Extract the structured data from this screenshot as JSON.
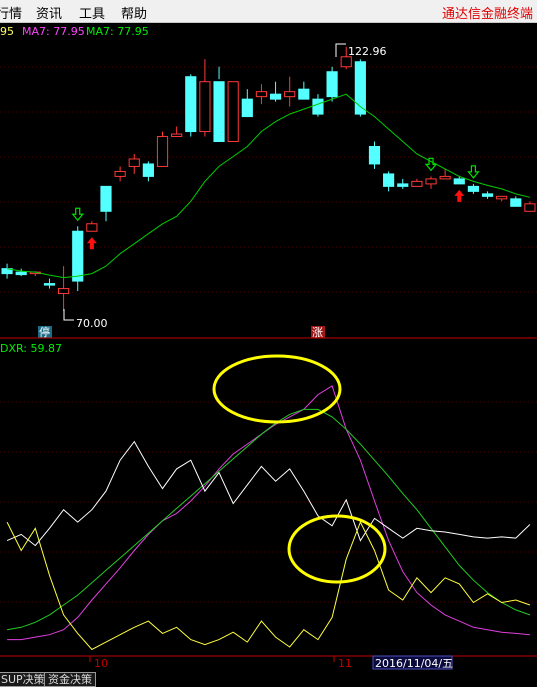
{
  "app": {
    "brand": "通达信金融终端"
  },
  "menu": [
    {
      "label": "行情"
    },
    {
      "label": "资讯"
    },
    {
      "label": "工具"
    },
    {
      "label": "帮助"
    }
  ],
  "colors": {
    "up": "#ff3838",
    "down": "#54ffff",
    "ma": "#00cc00",
    "ma_label_pink": "#ff44ff",
    "axis": "#c00000",
    "signal_buy": "#ff1010",
    "signal_sell": "#00dd00",
    "highlight": "#ffff00"
  },
  "main_chart": {
    "ma_labels": [
      "95",
      "MA7: 77.95",
      "MA7: 77.95"
    ],
    "high_label": "122.96",
    "low_label": "70.00",
    "badges": [
      "停",
      "涨"
    ]
  },
  "indicator": {
    "label": "DXR: 59.87"
  },
  "axis": {
    "labels": [
      "10",
      "11"
    ],
    "cursor_date": "2016/11/04/五"
  },
  "tabs": [
    {
      "label": "SUP决策"
    },
    {
      "label": "资金决策"
    }
  ],
  "chart_data": {
    "type": "candlestick",
    "candles": [
      {
        "o": 78.5,
        "h": 79.5,
        "l": 76.5,
        "c": 77.5
      },
      {
        "o": 77.8,
        "h": 78.5,
        "l": 77,
        "c": 77.3
      },
      {
        "o": 77.5,
        "h": 78,
        "l": 77,
        "c": 77.8
      },
      {
        "o": 75.5,
        "h": 76.5,
        "l": 74.5,
        "c": 75.2
      },
      {
        "o": 73.5,
        "h": 79,
        "l": 70,
        "c": 74.5
      },
      {
        "o": 86,
        "h": 87,
        "l": 74,
        "c": 76
      },
      {
        "o": 86,
        "h": 88,
        "l": 86,
        "c": 87.5
      },
      {
        "o": 95,
        "h": 95,
        "l": 88,
        "c": 90
      },
      {
        "o": 97,
        "h": 99,
        "l": 96,
        "c": 98
      },
      {
        "o": 99,
        "h": 101.5,
        "l": 97.5,
        "c": 100.5
      },
      {
        "o": 99.5,
        "h": 100,
        "l": 96,
        "c": 97
      },
      {
        "o": 99,
        "h": 106,
        "l": 99,
        "c": 105
      },
      {
        "o": 105,
        "h": 107,
        "l": 105,
        "c": 105.5
      },
      {
        "o": 117,
        "h": 117.5,
        "l": 105,
        "c": 106
      },
      {
        "o": 106,
        "h": 120.5,
        "l": 105,
        "c": 116
      },
      {
        "o": 116,
        "h": 119,
        "l": 116.5,
        "c": 104
      },
      {
        "o": 104,
        "h": 110,
        "l": 104,
        "c": 116
      },
      {
        "o": 112.5,
        "h": 114.5,
        "l": 111,
        "c": 109
      },
      {
        "o": 113,
        "h": 115.5,
        "l": 111.5,
        "c": 114
      },
      {
        "o": 113.5,
        "h": 116,
        "l": 112,
        "c": 112.5
      },
      {
        "o": 113,
        "h": 117,
        "l": 111,
        "c": 114
      },
      {
        "o": 114.5,
        "h": 116,
        "l": 112.5,
        "c": 112.5
      },
      {
        "o": 112.5,
        "h": 113.5,
        "l": 109,
        "c": 109.5
      },
      {
        "o": 118,
        "h": 119,
        "l": 112,
        "c": 113
      },
      {
        "o": 119,
        "h": 123,
        "l": 118.5,
        "c": 121
      },
      {
        "o": 120,
        "h": 120.5,
        "l": 109,
        "c": 109.5
      },
      {
        "o": 103,
        "h": 104,
        "l": 98.5,
        "c": 99.5
      },
      {
        "o": 97.5,
        "h": 98,
        "l": 94,
        "c": 95
      },
      {
        "o": 95.5,
        "h": 96.5,
        "l": 94.5,
        "c": 95
      },
      {
        "o": 95,
        "h": 96.5,
        "l": 95,
        "c": 96
      },
      {
        "o": 95.5,
        "h": 97,
        "l": 94.5,
        "c": 96.5
      },
      {
        "o": 96.5,
        "h": 98.5,
        "l": 96.5,
        "c": 97
      },
      {
        "o": 96.5,
        "h": 97,
        "l": 95.5,
        "c": 95.5
      },
      {
        "o": 95,
        "h": 95.5,
        "l": 93.5,
        "c": 94
      },
      {
        "o": 93.5,
        "h": 94,
        "l": 92.5,
        "c": 93
      },
      {
        "o": 92.5,
        "h": 93,
        "l": 92,
        "c": 93
      },
      {
        "o": 92.5,
        "h": 93,
        "l": 91,
        "c": 91
      },
      {
        "o": 90,
        "h": 92,
        "l": 90,
        "c": 91.5
      }
    ],
    "ma": [
      78.5,
      78,
      77.8,
      77.2,
      76.7,
      77,
      77.5,
      79,
      81.5,
      83.5,
      85.5,
      87.5,
      89,
      92,
      96,
      99,
      101,
      103,
      106,
      108,
      109.5,
      110.5,
      111.5,
      112.5,
      113.5,
      111,
      109,
      106.5,
      104,
      101.5,
      100,
      98.5,
      97,
      96,
      95.2,
      94.5,
      93.5,
      92.8
    ],
    "buy_signals": [
      6,
      32
    ],
    "sell_signals": [
      5,
      30,
      33
    ],
    "indicator_lines": {
      "magenta": [
        10,
        10,
        12,
        14,
        18,
        28,
        42,
        55,
        68,
        82,
        95,
        106,
        112,
        122,
        134,
        148,
        160,
        168,
        176,
        184,
        190,
        196,
        208,
        215,
        180,
        155,
        122,
        90,
        65,
        48,
        38,
        30,
        25,
        20,
        18,
        16,
        15,
        14
      ],
      "green": [
        18,
        20,
        24,
        30,
        38,
        46,
        56,
        66,
        76,
        86,
        96,
        106,
        116,
        126,
        136,
        146,
        156,
        166,
        176,
        185,
        192,
        196,
        196,
        190,
        180,
        168,
        155,
        142,
        128,
        115,
        100,
        85,
        70,
        58,
        48,
        40,
        34,
        30
      ],
      "white": [
        90,
        95,
        86,
        100,
        115,
        105,
        115,
        130,
        155,
        170,
        150,
        132,
        148,
        155,
        130,
        145,
        120,
        135,
        150,
        138,
        148,
        130,
        110,
        102,
        123,
        90,
        108,
        100,
        92,
        100,
        98,
        97,
        95,
        93,
        92,
        93,
        92,
        103
      ],
      "yellow": [
        105,
        82,
        100,
        62,
        30,
        15,
        2,
        8,
        14,
        20,
        25,
        15,
        20,
        10,
        6,
        10,
        16,
        8,
        25,
        12,
        4,
        18,
        10,
        28,
        75,
        105,
        82,
        50,
        42,
        60,
        48,
        60,
        55,
        40,
        47,
        40,
        42,
        38
      ]
    }
  }
}
